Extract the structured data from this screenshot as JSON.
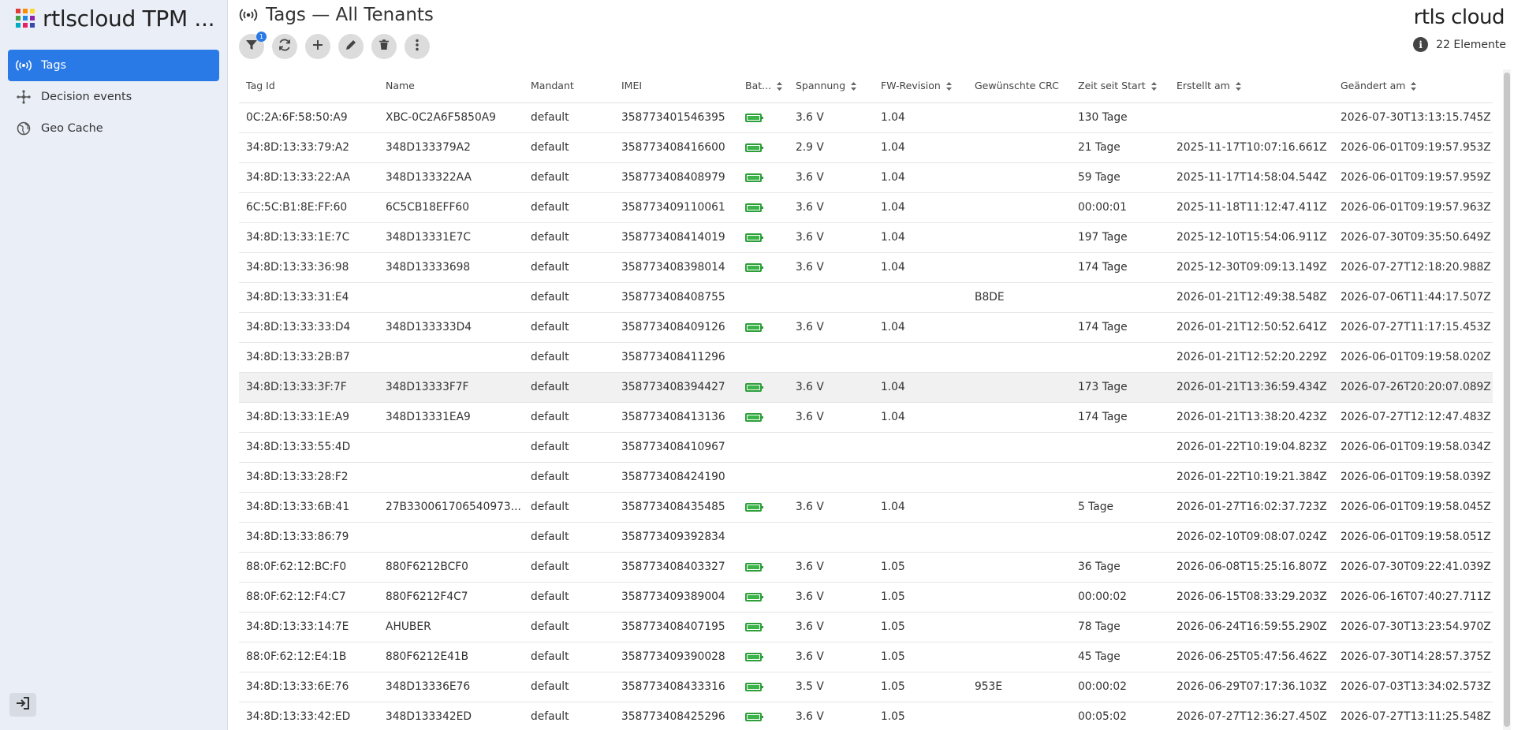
{
  "app": {
    "title": "rtlscloud TPM ...",
    "logo_text": "rtls cloud"
  },
  "sidebar": {
    "items": [
      {
        "label": "Tags",
        "icon": "broadcast-icon",
        "active": true
      },
      {
        "label": "Decision events",
        "icon": "hub-icon",
        "active": false
      },
      {
        "label": "Geo Cache",
        "icon": "globe-icon",
        "active": false
      }
    ],
    "logout_icon": "logout-icon"
  },
  "header": {
    "title": "Tags — All Tenants",
    "icon": "broadcast-icon"
  },
  "toolbar": {
    "filter_badge": "1",
    "buttons": [
      "filter-icon",
      "refresh-icon",
      "add-icon",
      "edit-icon",
      "delete-icon",
      "more-icon"
    ]
  },
  "count": {
    "label": "22 Elemente"
  },
  "colors": {
    "accent": "#2979e6",
    "battery": "#3bb54a",
    "sidebar_bg": "#e9eef7"
  },
  "table": {
    "columns": [
      "Tag Id",
      "Name",
      "Mandant",
      "IMEI",
      "Bat...",
      "Spannung",
      "FW-Revision",
      "Gewünschte CRC",
      "Zeit seit Start",
      "Erstellt am",
      "Geändert am"
    ],
    "rows": [
      {
        "tag_id": "0C:2A:6F:58:50:A9",
        "name": "XBC-0C2A6F5850A9",
        "mandant": "default",
        "imei": "358773401546395",
        "battery": true,
        "spannung": "3.6 V",
        "fw": "1.04",
        "crc": "",
        "zeit": "130 Tage",
        "erstellt": "",
        "geaendert": "2026-07-30T13:13:15.745Z"
      },
      {
        "tag_id": "34:8D:13:33:79:A2",
        "name": "348D133379A2",
        "mandant": "default",
        "imei": "358773408416600",
        "battery": true,
        "spannung": "2.9 V",
        "fw": "1.04",
        "crc": "",
        "zeit": "21 Tage",
        "erstellt": "2025-11-17T10:07:16.661Z",
        "geaendert": "2026-06-01T09:19:57.953Z"
      },
      {
        "tag_id": "34:8D:13:33:22:AA",
        "name": "348D133322AA",
        "mandant": "default",
        "imei": "358773408408979",
        "battery": true,
        "spannung": "3.6 V",
        "fw": "1.04",
        "crc": "",
        "zeit": "59 Tage",
        "erstellt": "2025-11-17T14:58:04.544Z",
        "geaendert": "2026-06-01T09:19:57.959Z"
      },
      {
        "tag_id": "6C:5C:B1:8E:FF:60",
        "name": "6C5CB18EFF60",
        "mandant": "default",
        "imei": "358773409110061",
        "battery": true,
        "spannung": "3.6 V",
        "fw": "1.04",
        "crc": "",
        "zeit": "00:00:01",
        "erstellt": "2025-11-18T11:12:47.411Z",
        "geaendert": "2026-06-01T09:19:57.963Z"
      },
      {
        "tag_id": "34:8D:13:33:1E:7C",
        "name": "348D13331E7C",
        "mandant": "default",
        "imei": "358773408414019",
        "battery": true,
        "spannung": "3.6 V",
        "fw": "1.04",
        "crc": "",
        "zeit": "197 Tage",
        "erstellt": "2025-12-10T15:54:06.911Z",
        "geaendert": "2026-07-30T09:35:50.649Z"
      },
      {
        "tag_id": "34:8D:13:33:36:98",
        "name": "348D13333698",
        "mandant": "default",
        "imei": "358773408398014",
        "battery": true,
        "spannung": "3.6 V",
        "fw": "1.04",
        "crc": "",
        "zeit": "174 Tage",
        "erstellt": "2025-12-30T09:09:13.149Z",
        "geaendert": "2026-07-27T12:18:20.988Z"
      },
      {
        "tag_id": "34:8D:13:33:31:E4",
        "name": "",
        "mandant": "default",
        "imei": "358773408408755",
        "battery": false,
        "spannung": "",
        "fw": "",
        "crc": "B8DE",
        "zeit": "",
        "erstellt": "2026-01-21T12:49:38.548Z",
        "geaendert": "2026-07-06T11:44:17.507Z"
      },
      {
        "tag_id": "34:8D:13:33:33:D4",
        "name": "348D133333D4",
        "mandant": "default",
        "imei": "358773408409126",
        "battery": true,
        "spannung": "3.6 V",
        "fw": "1.04",
        "crc": "",
        "zeit": "174 Tage",
        "erstellt": "2026-01-21T12:50:52.641Z",
        "geaendert": "2026-07-27T11:17:15.453Z"
      },
      {
        "tag_id": "34:8D:13:33:2B:B7",
        "name": "",
        "mandant": "default",
        "imei": "358773408411296",
        "battery": false,
        "spannung": "",
        "fw": "",
        "crc": "",
        "zeit": "",
        "erstellt": "2026-01-21T12:52:20.229Z",
        "geaendert": "2026-06-01T09:19:58.020Z"
      },
      {
        "tag_id": "34:8D:13:33:3F:7F",
        "name": "348D13333F7F",
        "mandant": "default",
        "imei": "358773408394427",
        "battery": true,
        "spannung": "3.6 V",
        "fw": "1.04",
        "crc": "",
        "zeit": "173 Tage",
        "erstellt": "2026-01-21T13:36:59.434Z",
        "geaendert": "2026-07-26T20:20:07.089Z",
        "highlight": true
      },
      {
        "tag_id": "34:8D:13:33:1E:A9",
        "name": "348D13331EA9",
        "mandant": "default",
        "imei": "358773408413136",
        "battery": true,
        "spannung": "3.6 V",
        "fw": "1.04",
        "crc": "",
        "zeit": "174 Tage",
        "erstellt": "2026-01-21T13:38:20.423Z",
        "geaendert": "2026-07-27T12:12:47.483Z"
      },
      {
        "tag_id": "34:8D:13:33:55:4D",
        "name": "",
        "mandant": "default",
        "imei": "358773408410967",
        "battery": false,
        "spannung": "",
        "fw": "",
        "crc": "",
        "zeit": "",
        "erstellt": "2026-01-22T10:19:04.823Z",
        "geaendert": "2026-06-01T09:19:58.034Z"
      },
      {
        "tag_id": "34:8D:13:33:28:F2",
        "name": "",
        "mandant": "default",
        "imei": "358773408424190",
        "battery": false,
        "spannung": "",
        "fw": "",
        "crc": "",
        "zeit": "",
        "erstellt": "2026-01-22T10:19:21.384Z",
        "geaendert": "2026-06-01T09:19:58.039Z"
      },
      {
        "tag_id": "34:8D:13:33:6B:41",
        "name": "27B330061706540973...",
        "mandant": "default",
        "imei": "358773408435485",
        "battery": true,
        "spannung": "3.6 V",
        "fw": "1.04",
        "crc": "",
        "zeit": "5 Tage",
        "erstellt": "2026-01-27T16:02:37.723Z",
        "geaendert": "2026-06-01T09:19:58.045Z"
      },
      {
        "tag_id": "34:8D:13:33:86:79",
        "name": "",
        "mandant": "default",
        "imei": "358773409392834",
        "battery": false,
        "spannung": "",
        "fw": "",
        "crc": "",
        "zeit": "",
        "erstellt": "2026-02-10T09:08:07.024Z",
        "geaendert": "2026-06-01T09:19:58.051Z"
      },
      {
        "tag_id": "88:0F:62:12:BC:F0",
        "name": "880F6212BCF0",
        "mandant": "default",
        "imei": "358773408403327",
        "battery": true,
        "spannung": "3.6 V",
        "fw": "1.05",
        "crc": "",
        "zeit": "36 Tage",
        "erstellt": "2026-06-08T15:25:16.807Z",
        "geaendert": "2026-07-30T09:22:41.039Z"
      },
      {
        "tag_id": "88:0F:62:12:F4:C7",
        "name": "880F6212F4C7",
        "mandant": "default",
        "imei": "358773409389004",
        "battery": true,
        "spannung": "3.6 V",
        "fw": "1.05",
        "crc": "",
        "zeit": "00:00:02",
        "erstellt": "2026-06-15T08:33:29.203Z",
        "geaendert": "2026-06-16T07:40:27.711Z"
      },
      {
        "tag_id": "34:8D:13:33:14:7E",
        "name": "AHUBER",
        "mandant": "default",
        "imei": "358773408407195",
        "battery": true,
        "spannung": "3.6 V",
        "fw": "1.05",
        "crc": "",
        "zeit": "78 Tage",
        "erstellt": "2026-06-24T16:59:55.290Z",
        "geaendert": "2026-07-30T13:23:54.970Z"
      },
      {
        "tag_id": "88:0F:62:12:E4:1B",
        "name": "880F6212E41B",
        "mandant": "default",
        "imei": "358773409390028",
        "battery": true,
        "spannung": "3.6 V",
        "fw": "1.05",
        "crc": "",
        "zeit": "45 Tage",
        "erstellt": "2026-06-25T05:47:56.462Z",
        "geaendert": "2026-07-30T14:28:57.375Z"
      },
      {
        "tag_id": "34:8D:13:33:6E:76",
        "name": "348D13336E76",
        "mandant": "default",
        "imei": "358773408433316",
        "battery": true,
        "spannung": "3.5 V",
        "fw": "1.05",
        "crc": "953E",
        "zeit": "00:00:02",
        "erstellt": "2026-06-29T07:17:36.103Z",
        "geaendert": "2026-07-03T13:34:02.573Z"
      },
      {
        "tag_id": "34:8D:13:33:42:ED",
        "name": "348D133342ED",
        "mandant": "default",
        "imei": "358773408425296",
        "battery": true,
        "spannung": "3.6 V",
        "fw": "1.05",
        "crc": "",
        "zeit": "00:05:02",
        "erstellt": "2026-07-27T12:36:27.450Z",
        "geaendert": "2026-07-27T13:11:25.548Z"
      }
    ]
  }
}
